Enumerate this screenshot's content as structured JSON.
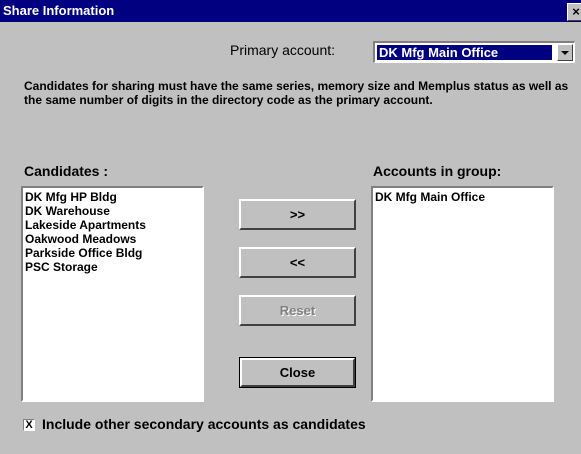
{
  "window": {
    "title": "Share Information",
    "close_glyph": "×"
  },
  "primary": {
    "label": "Primary account:",
    "selected": "DK Mfg Main Office"
  },
  "description": "Candidates for sharing must have the same series, memory size and  Memplus status as well as the same number of digits in the directory code as the primary account.",
  "candidates": {
    "label": "Candidates :",
    "items": [
      "DK Mfg HP Bldg",
      "DK Warehouse",
      "Lakeside Apartments",
      "Oakwood Meadows",
      "Parkside Office Bldg",
      "PSC Storage"
    ]
  },
  "group": {
    "label": "Accounts in group:",
    "items": [
      "DK Mfg Main Office"
    ]
  },
  "buttons": {
    "add": ">>",
    "remove": "<<",
    "reset": "Reset",
    "close": "Close"
  },
  "include_option": {
    "label": "Include other secondary accounts as candidates",
    "checked": true,
    "check_glyph": "X"
  }
}
